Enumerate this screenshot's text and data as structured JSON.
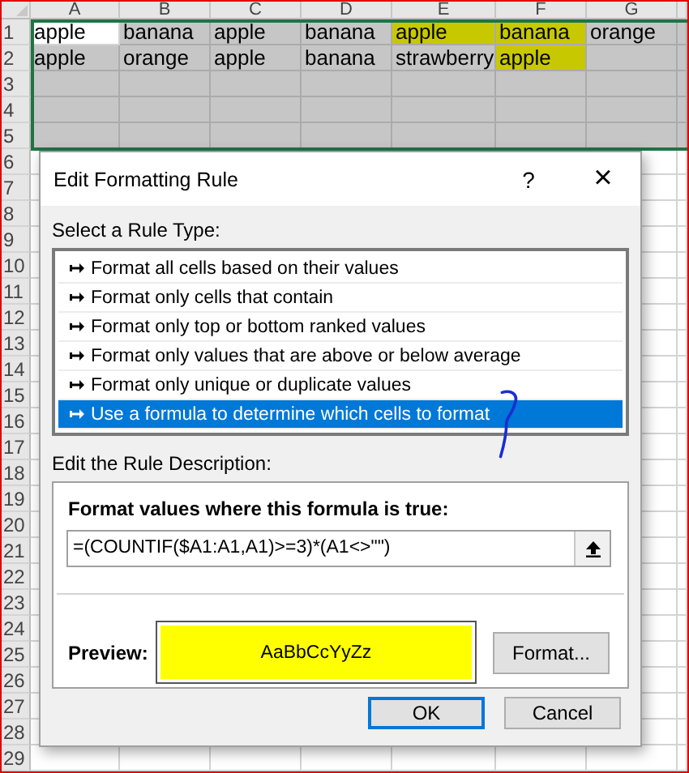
{
  "sheet": {
    "columns": [
      "A",
      "B",
      "C",
      "D",
      "E",
      "F",
      "G"
    ],
    "rows": [
      {
        "number": "1",
        "selected": true,
        "cells": [
          {
            "text": "apple",
            "active": true,
            "highlighted": false
          },
          {
            "text": "banana",
            "active": false,
            "highlighted": false
          },
          {
            "text": "apple",
            "active": false,
            "highlighted": false
          },
          {
            "text": "banana",
            "active": false,
            "highlighted": false
          },
          {
            "text": "apple",
            "active": false,
            "highlighted": true
          },
          {
            "text": "banana",
            "active": false,
            "highlighted": true
          },
          {
            "text": "orange",
            "active": false,
            "highlighted": false
          }
        ]
      },
      {
        "number": "2",
        "selected": true,
        "cells": [
          {
            "text": "apple",
            "active": false,
            "highlighted": false
          },
          {
            "text": "orange",
            "active": false,
            "highlighted": false
          },
          {
            "text": "apple",
            "active": false,
            "highlighted": false
          },
          {
            "text": "banana",
            "active": false,
            "highlighted": false
          },
          {
            "text": "strawberry",
            "active": false,
            "highlighted": false
          },
          {
            "text": "apple",
            "active": false,
            "highlighted": true
          },
          {
            "active": false,
            "highlighted": false
          }
        ]
      },
      {
        "number": "3",
        "selected": true
      },
      {
        "number": "4",
        "selected": true
      },
      {
        "number": "5",
        "selected": true
      },
      {
        "number": "6",
        "selected": false
      },
      {
        "number": "7",
        "selected": false
      },
      {
        "number": "8",
        "selected": false
      },
      {
        "number": "9",
        "selected": false
      },
      {
        "number": "10",
        "selected": false
      },
      {
        "number": "11",
        "selected": false
      },
      {
        "number": "12",
        "selected": false
      },
      {
        "number": "13",
        "selected": false
      },
      {
        "number": "14",
        "selected": false
      },
      {
        "number": "15",
        "selected": false
      },
      {
        "number": "16",
        "selected": false
      },
      {
        "number": "17",
        "selected": false
      },
      {
        "number": "18",
        "selected": false
      },
      {
        "number": "19",
        "selected": false
      },
      {
        "number": "20",
        "selected": false
      },
      {
        "number": "21",
        "selected": false
      },
      {
        "number": "22",
        "selected": false
      },
      {
        "number": "23",
        "selected": false
      },
      {
        "number": "24",
        "selected": false
      },
      {
        "number": "25",
        "selected": false
      },
      {
        "number": "26",
        "selected": false
      },
      {
        "number": "27",
        "selected": false
      },
      {
        "number": "28",
        "selected": false
      },
      {
        "number": "29",
        "selected": false
      }
    ]
  },
  "dialog": {
    "title": "Edit Formatting Rule",
    "help": "?",
    "close": "×",
    "rule_type_label": "Select a Rule Type:",
    "rule_types": [
      {
        "label": "Format all cells based on their values",
        "selected": false
      },
      {
        "label": "Format only cells that contain",
        "selected": false
      },
      {
        "label": "Format only top or bottom ranked values",
        "selected": false
      },
      {
        "label": "Format only values that are above or below average",
        "selected": false
      },
      {
        "label": "Format only unique or duplicate values",
        "selected": false
      },
      {
        "label": "Use a formula to determine which cells to format",
        "selected": true
      }
    ],
    "description_label": "Edit the Rule Description:",
    "formula_label": "Format values where this formula is true:",
    "formula": "=(COUNTIF($A1:A1,A1)>=3)*(A1<>\"\")",
    "preview_label": "Preview:",
    "preview_text": "AaBbCcYyZz",
    "format_button": "Format...",
    "buttons": [
      {
        "label": "OK",
        "kind": "default"
      },
      {
        "label": "Cancel",
        "kind": "normal"
      }
    ]
  }
}
